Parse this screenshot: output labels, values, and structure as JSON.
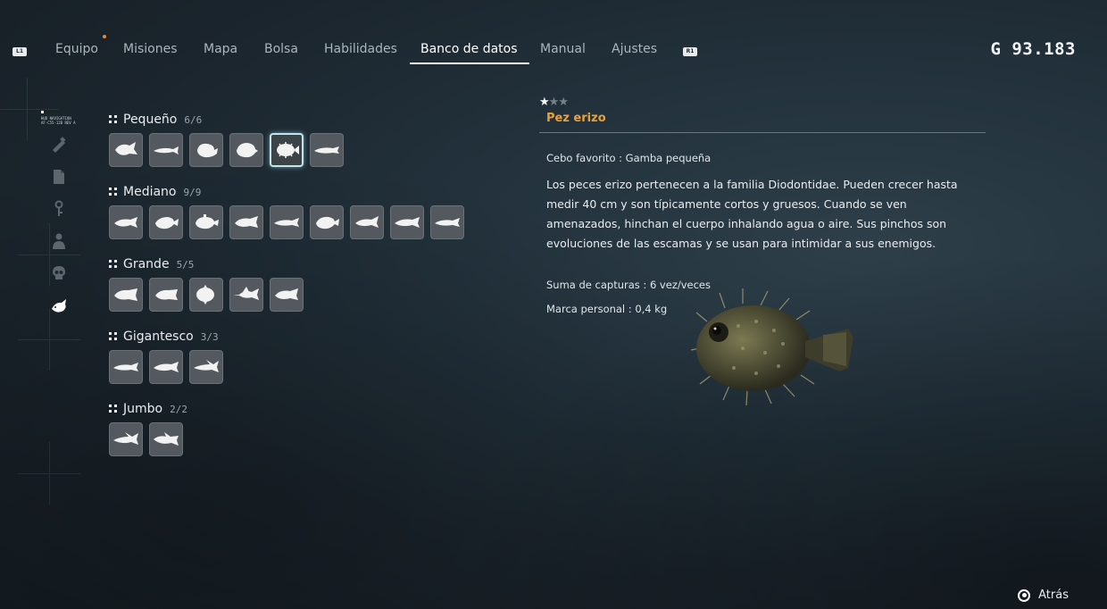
{
  "nav": {
    "left_bumper": "L1",
    "right_bumper": "R1",
    "tabs": [
      {
        "label": "Equipo"
      },
      {
        "label": "Misiones"
      },
      {
        "label": "Mapa"
      },
      {
        "label": "Bolsa"
      },
      {
        "label": "Habilidades"
      },
      {
        "label": "Banco de datos"
      },
      {
        "label": "Manual"
      },
      {
        "label": "Ajustes"
      }
    ],
    "active_tab": "Banco de datos"
  },
  "currency": {
    "symbol": "G",
    "amount": "93.183"
  },
  "sidebar": {
    "nav_caption": [
      "HUD NAVIGATION",
      "AF-C55-12B REV A"
    ],
    "items": [
      "wrench-icon",
      "document-icon",
      "key-icon",
      "person-icon",
      "skull-icon",
      "fish-icon"
    ],
    "active_item": "fish-icon"
  },
  "categories": [
    {
      "name": "Pequeño",
      "count": "6/6",
      "slots": 6,
      "selected_slot": 5
    },
    {
      "name": "Mediano",
      "count": "9/9",
      "slots": 9
    },
    {
      "name": "Grande",
      "count": "5/5",
      "slots": 5
    },
    {
      "name": "Gigantesco",
      "count": "3/3",
      "slots": 3
    },
    {
      "name": "Jumbo",
      "count": "2/2",
      "slots": 2
    }
  ],
  "detail": {
    "rating": 1,
    "rating_max": 3,
    "name": "Pez erizo",
    "bait": "Cebo favorito : Gamba pequeña",
    "description": "Los peces erizo pertenecen a la familia Diodontidae. Pueden crecer hasta medir 40 cm y son típicamente cortos y gruesos. Cuando se ven amenazados, hinchan el cuerpo inhalando agua o aire. Sus pinchos son evoluciones de las escamas y se usan para intimidar a sus enemigos.",
    "catch_total": "Suma de capturas : 6 vez/veces",
    "personal_best": "Marca personal : 0,4 kg"
  },
  "footer": {
    "back_label": "Atrás"
  },
  "colors": {
    "accent_name": "#e8a23c",
    "notification_dot": "#e8873c",
    "selected_glow": "#bfe6ef"
  }
}
